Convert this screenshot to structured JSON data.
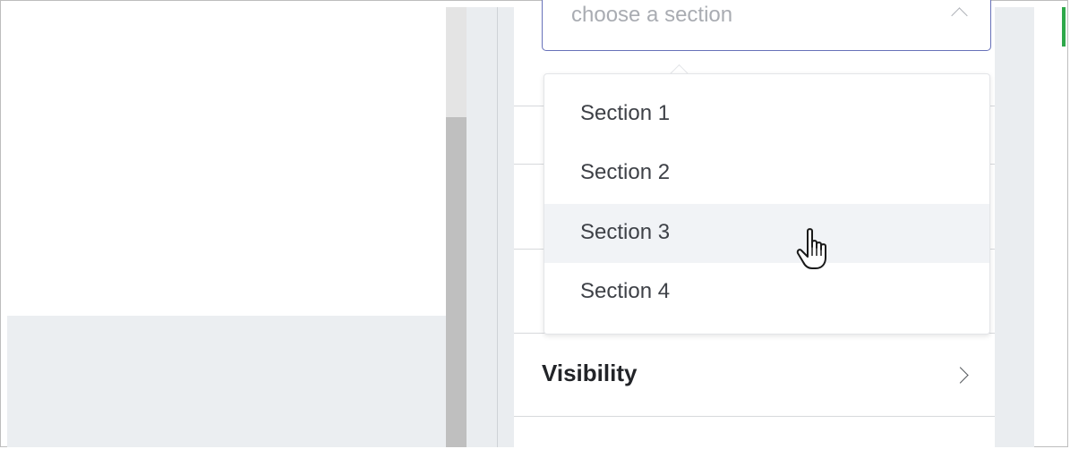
{
  "section_select": {
    "placeholder": "choose a section",
    "options": [
      {
        "label": "Section 1"
      },
      {
        "label": "Section 2"
      },
      {
        "label": "Section 3",
        "hovered": true
      },
      {
        "label": "Section 4"
      }
    ]
  },
  "settings_rows": {
    "visibility_label": "Visibility"
  },
  "colors": {
    "select_border": "#6771b9",
    "hover_background": "#f1f3f6",
    "gutter_background": "#eaedf0",
    "accent_green": "#2ea84a"
  },
  "icons": {
    "select_chevron": "chevron-up-icon",
    "row_chevron": "chevron-right-icon",
    "cursor": "hand-pointer-cursor-icon"
  }
}
